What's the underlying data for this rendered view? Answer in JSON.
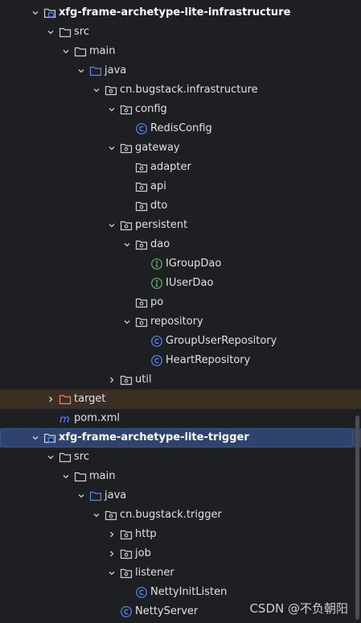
{
  "tree": [
    {
      "depth": 0,
      "kind": "module",
      "expanded": true,
      "label": "xfg-frame-archetype-lite-infrastructure",
      "name": "module-infrastructure"
    },
    {
      "depth": 1,
      "kind": "folder",
      "expanded": true,
      "label": "src",
      "name": "folder-src"
    },
    {
      "depth": 2,
      "kind": "folder",
      "expanded": true,
      "label": "main",
      "name": "folder-main"
    },
    {
      "depth": 3,
      "kind": "source-folder",
      "expanded": true,
      "label": "java",
      "name": "folder-java"
    },
    {
      "depth": 4,
      "kind": "package",
      "expanded": true,
      "label": "cn.bugstack.infrastructure",
      "name": "package-cn-bugstack-infrastructure"
    },
    {
      "depth": 5,
      "kind": "package",
      "expanded": true,
      "label": "config",
      "name": "package-config"
    },
    {
      "depth": 6,
      "kind": "class",
      "label": "RedisConfig",
      "name": "class-redisconfig"
    },
    {
      "depth": 5,
      "kind": "package",
      "expanded": true,
      "label": "gateway",
      "name": "package-gateway"
    },
    {
      "depth": 6,
      "kind": "package",
      "label": "adapter",
      "name": "package-adapter"
    },
    {
      "depth": 6,
      "kind": "package",
      "label": "api",
      "name": "package-api"
    },
    {
      "depth": 6,
      "kind": "package",
      "label": "dto",
      "name": "package-dto"
    },
    {
      "depth": 5,
      "kind": "package",
      "expanded": true,
      "label": "persistent",
      "name": "package-persistent"
    },
    {
      "depth": 6,
      "kind": "package",
      "expanded": true,
      "label": "dao",
      "name": "package-dao"
    },
    {
      "depth": 7,
      "kind": "interface",
      "label": "IGroupDao",
      "name": "interface-igroupdao"
    },
    {
      "depth": 7,
      "kind": "interface",
      "label": "IUserDao",
      "name": "interface-iuserdao"
    },
    {
      "depth": 6,
      "kind": "package",
      "label": "po",
      "name": "package-po"
    },
    {
      "depth": 6,
      "kind": "package",
      "expanded": true,
      "label": "repository",
      "name": "package-repository"
    },
    {
      "depth": 7,
      "kind": "class",
      "label": "GroupUserRepository",
      "name": "class-groupuserrepository"
    },
    {
      "depth": 7,
      "kind": "class",
      "label": "HeartRepository",
      "name": "class-heartrepository"
    },
    {
      "depth": 5,
      "kind": "package",
      "expanded": false,
      "label": "util",
      "name": "package-util"
    },
    {
      "depth": 1,
      "kind": "excluded-folder",
      "expanded": false,
      "label": "target",
      "name": "folder-target"
    },
    {
      "depth": 1,
      "kind": "maven",
      "label": "pom.xml",
      "name": "file-pom-xml"
    },
    {
      "depth": 0,
      "kind": "module",
      "expanded": true,
      "selected": true,
      "label": "xfg-frame-archetype-lite-trigger",
      "name": "module-trigger"
    },
    {
      "depth": 1,
      "kind": "folder",
      "expanded": true,
      "label": "src",
      "name": "folder-src"
    },
    {
      "depth": 2,
      "kind": "folder",
      "expanded": true,
      "label": "main",
      "name": "folder-main"
    },
    {
      "depth": 3,
      "kind": "source-folder",
      "expanded": true,
      "label": "java",
      "name": "folder-java"
    },
    {
      "depth": 4,
      "kind": "package",
      "expanded": true,
      "label": "cn.bugstack.trigger",
      "name": "package-cn-bugstack-trigger"
    },
    {
      "depth": 5,
      "kind": "package",
      "expanded": false,
      "label": "http",
      "name": "package-http"
    },
    {
      "depth": 5,
      "kind": "package",
      "expanded": false,
      "label": "job",
      "name": "package-job"
    },
    {
      "depth": 5,
      "kind": "package",
      "expanded": true,
      "label": "listener",
      "name": "package-listener"
    },
    {
      "depth": 6,
      "kind": "class",
      "label": "NettyInitListen",
      "name": "class-nettyinitlisten"
    },
    {
      "depth": 5,
      "kind": "class",
      "label": "NettyServer",
      "name": "class-nettyserver"
    }
  ],
  "watermark": "CSDN @不负朝阳",
  "colors": {
    "background": "#1e1f22",
    "text": "#dfe1e5",
    "selection": "#2e436e",
    "class_icon": "#548af7",
    "interface_icon": "#5fb865",
    "folder_icon": "#ced0d6",
    "source_folder_icon": "#548af7",
    "excluded_folder_icon": "#e88c5a",
    "maven_icon": "#548af7"
  }
}
